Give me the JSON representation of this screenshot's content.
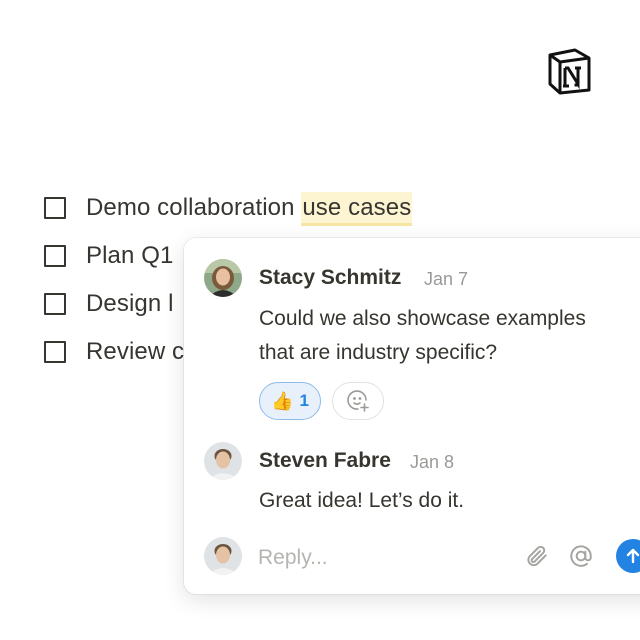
{
  "logo": {
    "icon": "notion-logo-icon",
    "letter": "N"
  },
  "todos": [
    {
      "text": "Demo collaboration ",
      "highlight": "use cases",
      "checked": false
    },
    {
      "text": "Plan Q1",
      "checked": false
    },
    {
      "text": "Design l",
      "checked": false
    },
    {
      "text": "Review c",
      "checked": false
    }
  ],
  "comments": [
    {
      "author": "Stacy Schmitz",
      "date": "Jan 7",
      "lines": [
        "Could we also showcase examples",
        "that are industry specific?"
      ],
      "reaction": {
        "emoji": "👍",
        "count": "1"
      }
    },
    {
      "author": "Steven Fabre",
      "date": "Jan 8",
      "lines": [
        "Great idea! Let’s do it."
      ]
    }
  ],
  "reply": {
    "placeholder": "Reply...",
    "value": ""
  },
  "icons": {
    "attach": "paperclip-icon",
    "mention": "at-sign-icon",
    "send": "arrow-up-icon",
    "add_reaction": "add-emoji-icon"
  },
  "colors": {
    "text": "#37352f",
    "muted": "#9b9a97",
    "highlight_bg": "#fdf5d1",
    "accent": "#2383e2",
    "reaction_bg": "#e8f1fb"
  }
}
